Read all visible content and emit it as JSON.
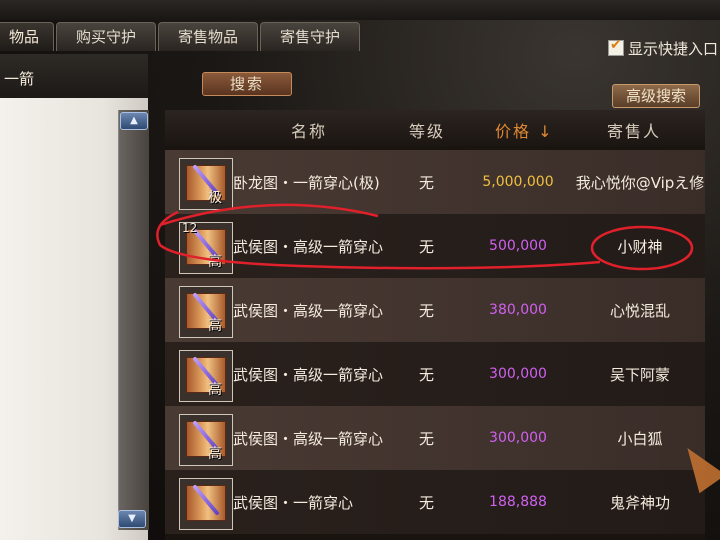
{
  "window": {
    "title": ""
  },
  "tabs": [
    {
      "label": "物品"
    },
    {
      "label": "购买守护"
    },
    {
      "label": "寄售物品"
    },
    {
      "label": "寄售守护"
    }
  ],
  "quick_toggle": {
    "label": "显示快捷入口",
    "checked": true
  },
  "left_panel": {
    "filter_text": "一箭"
  },
  "search": {
    "label": "搜索"
  },
  "advanced_search": {
    "label": "高级搜索"
  },
  "table": {
    "headers": {
      "name": "名称",
      "level": "等级",
      "price": "价格 ↓",
      "seller": "寄售人"
    },
    "rows": [
      {
        "grade": "极",
        "stack": "",
        "name": "卧龙图・一箭穿心(极)",
        "level": "无",
        "price": "5,000,000",
        "price_color": "gold",
        "seller": "我心悦你@Vipえ修"
      },
      {
        "grade": "高",
        "stack": "12",
        "name": "武侯图・高级一箭穿心",
        "level": "无",
        "price": "500,000",
        "price_color": "purple",
        "seller": "小财神"
      },
      {
        "grade": "高",
        "stack": "",
        "name": "武侯图・高级一箭穿心",
        "level": "无",
        "price": "380,000",
        "price_color": "purple",
        "seller": "心悦混乱"
      },
      {
        "grade": "高",
        "stack": "",
        "name": "武侯图・高级一箭穿心",
        "level": "无",
        "price": "300,000",
        "price_color": "purple",
        "seller": "吴下阿蒙"
      },
      {
        "grade": "高",
        "stack": "",
        "name": "武侯图・高级一箭穿心",
        "level": "无",
        "price": "300,000",
        "price_color": "purple",
        "seller": "小白狐"
      },
      {
        "grade": "",
        "stack": "",
        "name": "武侯图・一箭穿心",
        "level": "无",
        "price": "188,888",
        "price_color": "purple",
        "seller": "鬼斧神功"
      }
    ]
  },
  "colors": {
    "price_gold": "#f0c040",
    "price_purple": "#d060f0",
    "annotation_red": "#e0202a"
  },
  "icons": {
    "scroll_up": "chevron-up-icon",
    "scroll_down": "chevron-down-icon",
    "item": "scroll-item-icon"
  }
}
